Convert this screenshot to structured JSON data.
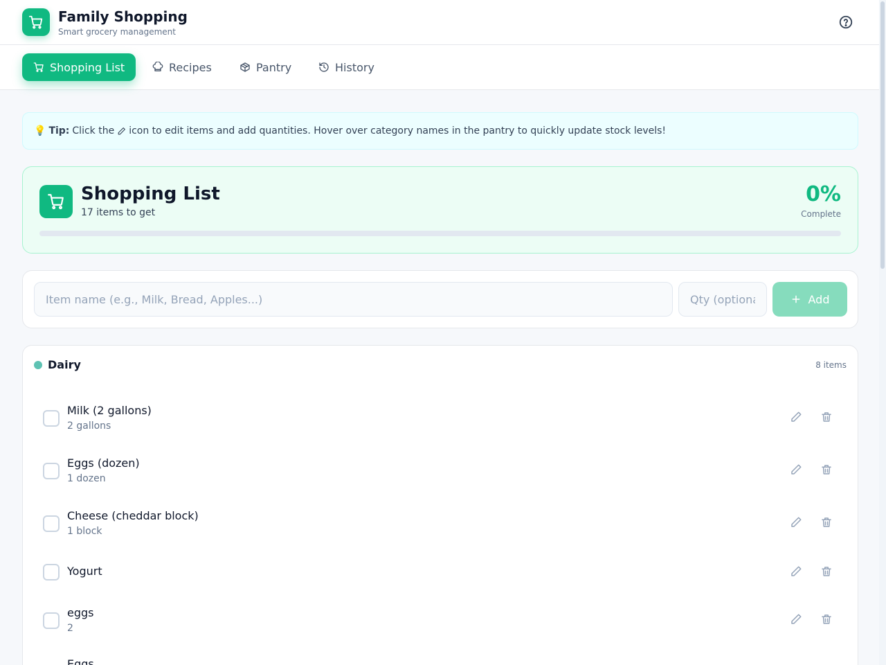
{
  "app": {
    "title": "Family Shopping",
    "subtitle": "Smart grocery management"
  },
  "nav": {
    "tabs": [
      {
        "label": "Shopping List",
        "icon": "cart-icon",
        "active": true
      },
      {
        "label": "Recipes",
        "icon": "chef-hat-icon",
        "active": false
      },
      {
        "label": "Pantry",
        "icon": "package-icon",
        "active": false
      },
      {
        "label": "History",
        "icon": "history-icon",
        "active": false
      }
    ]
  },
  "tip": {
    "emoji": "💡",
    "label": "Tip:",
    "text_before": "Click the",
    "text_after": "icon to edit items and add quantities. Hover over category names in the pantry to quickly update stock levels!"
  },
  "summary": {
    "title": "Shopping List",
    "subtitle": "17 items to get",
    "percent": "0%",
    "percent_label": "Complete",
    "progress_fraction": 0
  },
  "add_form": {
    "item_placeholder": "Item name (e.g., Milk, Bread, Apples...)",
    "item_value": "",
    "qty_placeholder": "Qty (optional)",
    "qty_value": "",
    "add_label": "Add"
  },
  "category": {
    "name": "Dairy",
    "count": "8 items",
    "dot_color": "#5ec2b3",
    "items": [
      {
        "name": "Milk (2 gallons)",
        "qty": "2 gallons"
      },
      {
        "name": "Eggs (dozen)",
        "qty": "1 dozen"
      },
      {
        "name": "Cheese (cheddar block)",
        "qty": "1 block"
      },
      {
        "name": "Yogurt",
        "qty": ""
      },
      {
        "name": "eggs",
        "qty": "2"
      },
      {
        "name": "Eggs",
        "qty": ""
      }
    ]
  },
  "colors": {
    "accent": "#10b981",
    "accent_light": "#ecfdf5"
  }
}
